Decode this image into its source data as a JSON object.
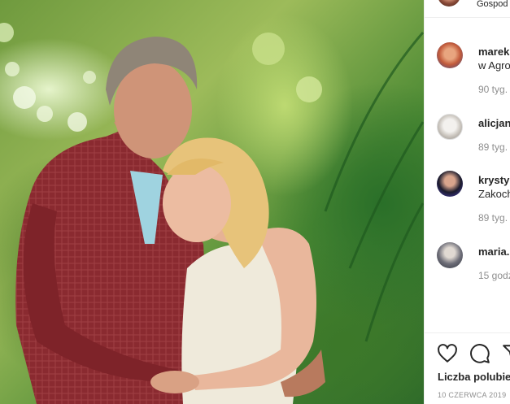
{
  "post": {
    "image_alt": "Couple embracing in a green forest"
  },
  "header": {
    "text": "Gospod"
  },
  "comments": [
    {
      "user": "marek",
      "text": "w Agro",
      "time": "90 tyg."
    },
    {
      "user": "alicjan",
      "text": "",
      "time": "89 tyg."
    },
    {
      "user": "krystyn",
      "text": "Zakoch",
      "time": "89 tyg."
    },
    {
      "user": "maria.",
      "text": "",
      "time": "15 godz"
    }
  ],
  "actions": {
    "like_icon": "heart-icon",
    "comment_icon": "comment-icon",
    "share_icon": "share-icon",
    "likes_label": "Liczba polubie",
    "date": "10 CZERWCA 2019"
  },
  "colors": {
    "text": "#262626",
    "muted": "#8e8e8e",
    "border": "#efefef"
  }
}
